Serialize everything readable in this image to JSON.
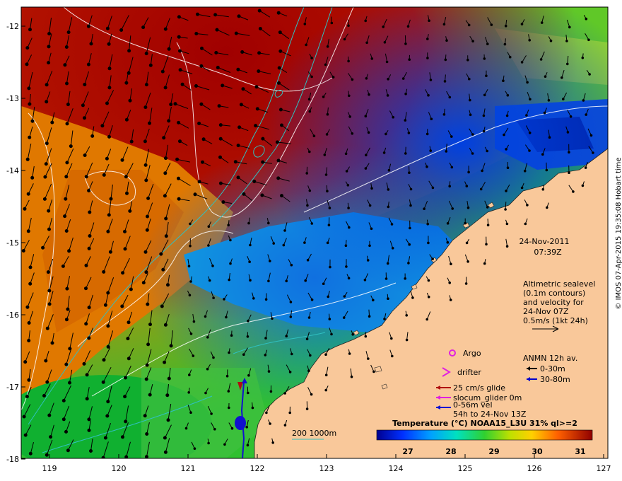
{
  "map": {
    "lon_ticks": [
      "119",
      "120",
      "121",
      "122",
      "123",
      "124",
      "125",
      "126",
      "127"
    ],
    "lat_ticks": [
      "-12",
      "-13",
      "-14",
      "-15",
      "-16",
      "-17",
      "-18"
    ],
    "date_line1": "24-Nov-2011",
    "date_line2": "07:39Z",
    "altimetry_notes": [
      "Altimetric sealevel",
      "(0.1m contours)",
      "and velocity for",
      "24-Nov 07Z",
      "0.5m/s (1kt 24h)"
    ],
    "argo_label": "Argo",
    "drifter_label": "drifter",
    "glider_labels": [
      "25 cm/s glide",
      "slocum_glider 0m",
      "0-56m vel",
      "54h to 24-Nov 13Z"
    ],
    "anmn_title": "ANMN 12h av.",
    "anmn_items": [
      "0-30m",
      "30-80m"
    ],
    "depth_label": "200  1000m",
    "credit": "© IMOS 07-Apr-2015 19:35:08 Hobart time",
    "colorbar_title": "Temperature (°C) NOAA15_L3U 31% ql>=2",
    "colorbar_ticks": [
      "27",
      "28",
      "29",
      "30",
      "31"
    ],
    "colors": {
      "land": "#f9c89a",
      "argo": "#e020e0",
      "drifter": "#e020e0",
      "glide_arrow": "#b01010",
      "slocum_arrow": "#e020e0",
      "vel_arrow": "#1010d0",
      "anmn_shallow": "#000000",
      "anmn_deep": "#0000cc",
      "isobath": "#30c0c0"
    }
  }
}
